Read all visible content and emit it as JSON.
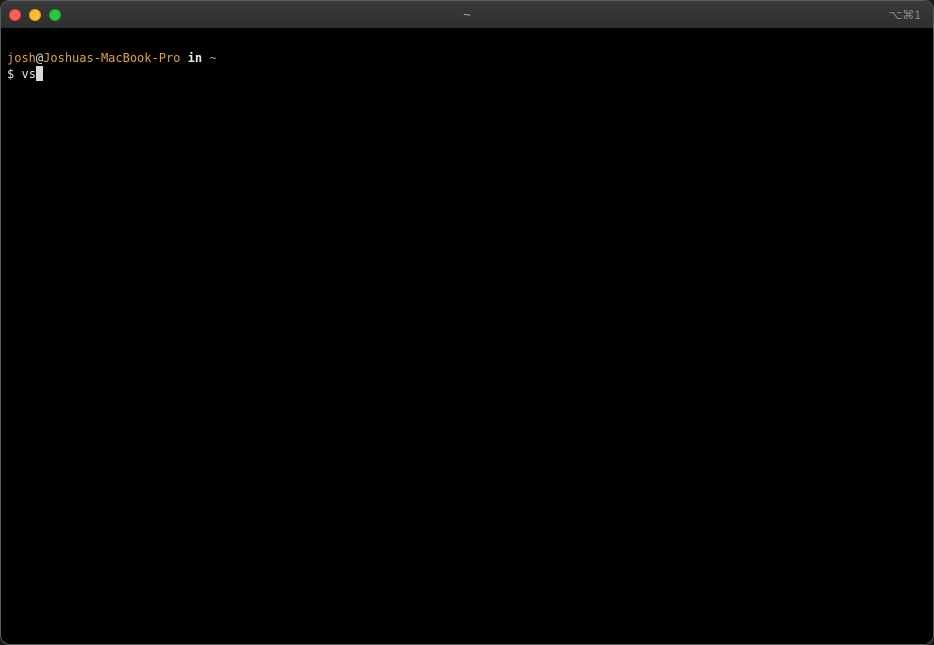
{
  "window": {
    "title": "~",
    "shortcut": "⌥⌘1"
  },
  "colors": {
    "user": "#e0a33a",
    "host": "#e0a33a",
    "background": "#000000",
    "cursor": "#d9d9d9"
  },
  "terminal": {
    "prompt_line": {
      "user": "josh",
      "at": "@",
      "host": "Joshuas-MacBook-Pro",
      "in_word": "in",
      "cwd": "~"
    },
    "input_line": {
      "prompt_symbol": "$",
      "typed_text": "vs"
    }
  }
}
